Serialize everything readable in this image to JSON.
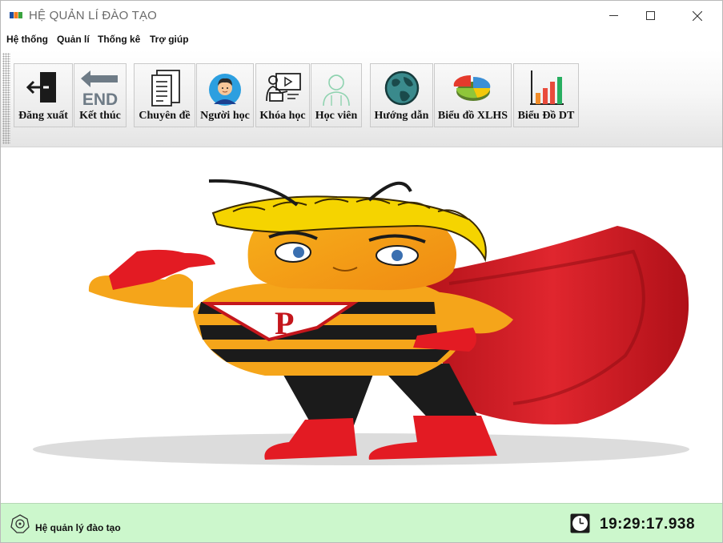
{
  "window": {
    "title": "HỆ QUẢN LÍ ĐÀO TẠO",
    "controls": {
      "minimize": "minimize",
      "maximize": "maximize",
      "close": "close"
    }
  },
  "menu": [
    "Hệ thống",
    "Quản lí",
    "Thống kê",
    "Trợ giúp"
  ],
  "toolbar": [
    {
      "label": "Đăng xuất",
      "icon": "logout-icon"
    },
    {
      "label": "Kết thúc",
      "icon": "end-icon"
    },
    {
      "label": "Chuyên đề",
      "icon": "document-icon"
    },
    {
      "label": "Người học",
      "icon": "learner-icon"
    },
    {
      "label": "Khóa học",
      "icon": "course-icon"
    },
    {
      "label": "Học viên",
      "icon": "student-icon"
    },
    {
      "label": "Hướng dẫn",
      "icon": "globe-icon"
    },
    {
      "label": "Biểu đồ XLHS",
      "icon": "pie-chart-icon"
    },
    {
      "label": "Biểu Đồ DT",
      "icon": "bar-chart-icon"
    }
  ],
  "content": {
    "image": "superhero-mascot-image",
    "chest_letter": "P"
  },
  "status": {
    "text": "Hệ quản lý đào tạo",
    "time": "19:29:17.938"
  },
  "colors": {
    "status_bg": "#ccf7cc",
    "toolbar_bg": "#f1f1f1",
    "hero_red": "#e31b23",
    "hero_yellow": "#f5d400"
  }
}
